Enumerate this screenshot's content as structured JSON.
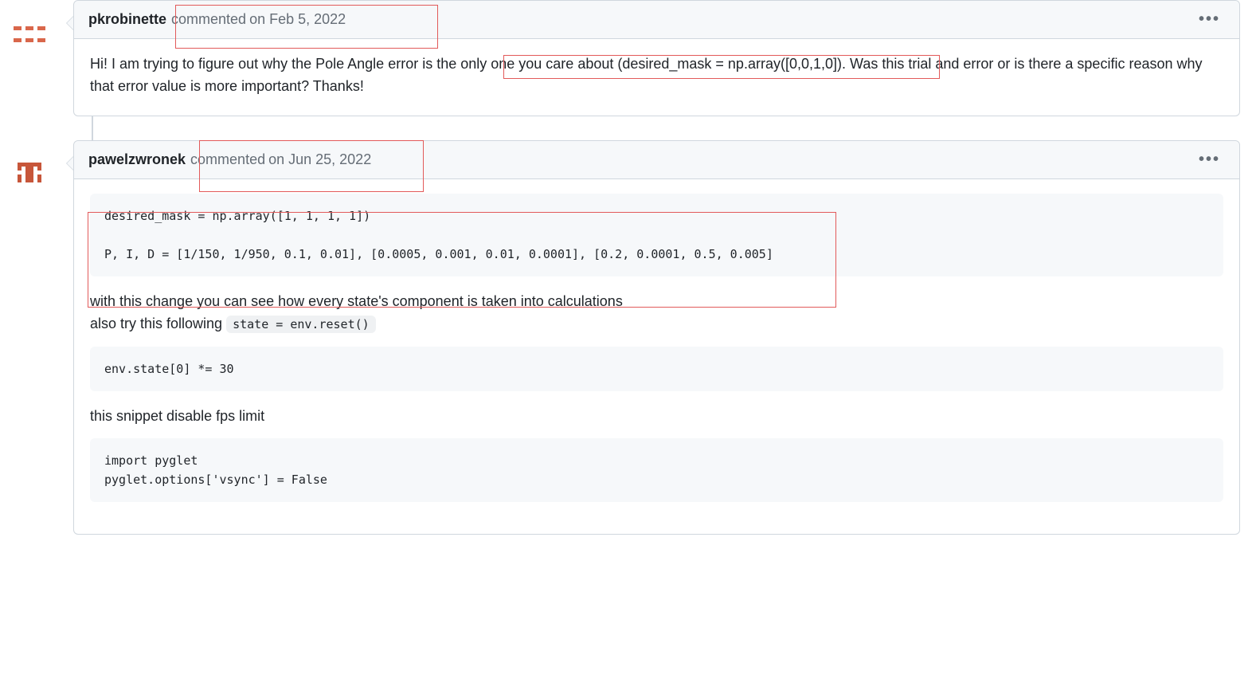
{
  "comments": [
    {
      "author": "pkrobinette",
      "commented_label": "commented",
      "timestamp": "on Feb 5, 2022",
      "body_text": "Hi! I am trying to figure out why the Pole Angle error is the only one you care about (desired_mask = np.array([0,0,1,0]). Was this trial and error or is there a specific reason why that error value is more important? Thanks!"
    },
    {
      "author": "pawelzwronek",
      "commented_label": "commented",
      "timestamp": "on Jun 25, 2022",
      "code_block_1": "desired_mask = np.array([1, 1, 1, 1])\n\nP, I, D = [1/150, 1/950, 0.1, 0.01], [0.0005, 0.001, 0.01, 0.0001], [0.2, 0.0001, 0.5, 0.005]",
      "para_1_prefix": "with this change you can see how every state's component is taken into calculations",
      "para_1_line2_prefix": "also try this following ",
      "inline_code_1": "state = env.reset()",
      "code_block_2": "env.state[0] *= 30",
      "para_2": "this snippet disable fps limit",
      "code_block_3": "import pyglet\npyglet.options['vsync'] = False"
    }
  ],
  "icons": {
    "kebab": "•••"
  }
}
